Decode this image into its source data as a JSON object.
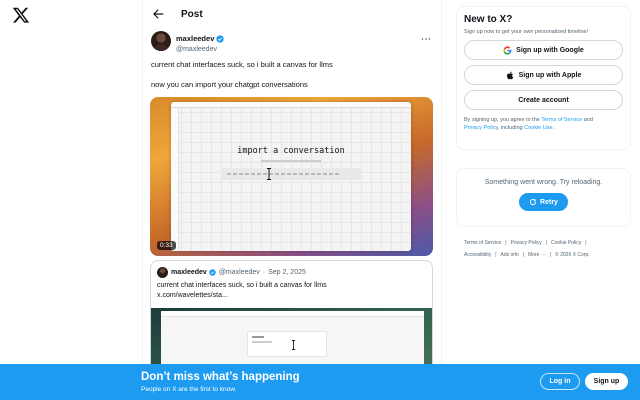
{
  "header": {
    "title": "Post"
  },
  "tweet": {
    "author": {
      "display_name": "maxleedev",
      "handle": "@maxleedev"
    },
    "text_line1": "current chat interfaces suck, so i built a canvas for llms",
    "text_line2": "now you can import your chatgpt conversations",
    "media": {
      "screen_title": "import a conversation",
      "duration": "0:33"
    }
  },
  "quote": {
    "display_name": "maxleedev",
    "handle": "@maxleedev",
    "separator": "·",
    "date": "Sep 2, 2025",
    "text_line1": "current chat interfaces suck, so i built a canvas for llms",
    "text_line2": "x.com/wavelettes/sta..."
  },
  "signup_card": {
    "title": "New to X?",
    "subtitle": "Sign up now to get your own personalized timeline!",
    "google_label": "Sign up with Google",
    "apple_label": "Sign up with Apple",
    "create_label": "Create account",
    "legal_prefix": "By signing up, you agree to the ",
    "terms_link": "Terms of Service",
    "and": " and",
    "privacy_link": "Privacy Policy",
    "including": ", including ",
    "cookie_link": "Cookie Use",
    "period": "."
  },
  "error_card": {
    "message": "Something went wrong. Try reloading.",
    "retry_label": "Retry"
  },
  "footer": {
    "terms": "Terms of Service",
    "privacy": "Privacy Policy",
    "cookie": "Cookie Policy",
    "accessibility": "Accessibility",
    "ads": "Ads info",
    "more": "More ···",
    "copyright": "© 2026 X Corp.",
    "sep": "|"
  },
  "bottom_bar": {
    "title": "Don’t miss what’s happening",
    "subtitle": "People on X are the first to know.",
    "login_label": "Log in",
    "signup_label": "Sign up"
  },
  "colors": {
    "accent": "#1d9bf0",
    "text": "#0f1419",
    "muted": "#536471"
  }
}
